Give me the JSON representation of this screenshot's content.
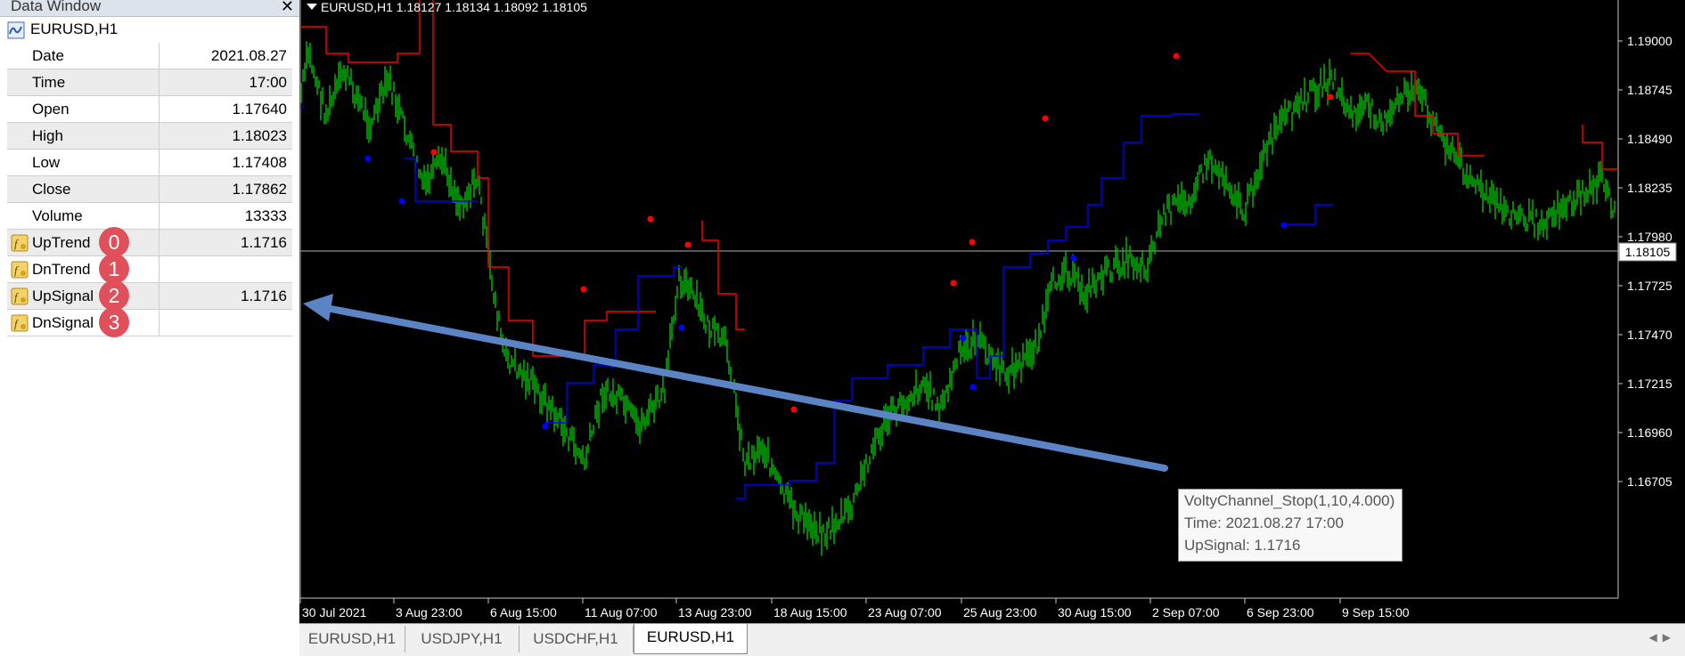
{
  "data_window": {
    "title": "Data Window",
    "symbol": "EURUSD,H1",
    "rows": [
      {
        "name": "Date",
        "value": "2021.08.27"
      },
      {
        "name": "Time",
        "value": "17:00"
      },
      {
        "name": "Open",
        "value": "1.17640"
      },
      {
        "name": "High",
        "value": "1.18023"
      },
      {
        "name": "Low",
        "value": "1.17408"
      },
      {
        "name": "Close",
        "value": "1.17862"
      },
      {
        "name": "Volume",
        "value": "13333"
      }
    ],
    "indicators": [
      {
        "name": "UpTrend",
        "value": "1.1716",
        "badge": "0"
      },
      {
        "name": "DnTrend",
        "value": "",
        "badge": "1"
      },
      {
        "name": "UpSignal",
        "value": "1.1716",
        "badge": "2"
      },
      {
        "name": "DnSignal",
        "value": "",
        "badge": "3"
      }
    ]
  },
  "chart": {
    "header": "EURUSD,H1  1.18127 1.18134 1.18092 1.18105",
    "current_price": "1.18105",
    "price_labels": [
      "1.19000",
      "1.18745",
      "1.18490",
      "1.18235",
      "1.17980",
      "1.17725",
      "1.17470",
      "1.17215",
      "1.16960",
      "1.16705"
    ],
    "time_labels": [
      "30 Jul 2021",
      "3 Aug 23:00",
      "6 Aug 15:00",
      "11 Aug 07:00",
      "13 Aug 23:00",
      "18 Aug 15:00",
      "23 Aug 07:00",
      "25 Aug 23:00",
      "30 Aug 15:00",
      "2 Sep 07:00",
      "6 Sep 23:00",
      "9 Sep 15:00"
    ],
    "colors": {
      "candles": "#00c000",
      "uptrend": "#0000ff",
      "dntrend": "#ff0000",
      "arrow": "#5b84c4",
      "background": "#000000"
    }
  },
  "tooltip": {
    "line1": "VoltyChannel_Stop(1,10,4.000)",
    "line2": "Time: 2021.08.27 17:00",
    "line3": "UpSignal: 1.1716"
  },
  "tabs": [
    {
      "label": "EURUSD,H1",
      "active": false
    },
    {
      "label": "USDJPY,H1",
      "active": false
    },
    {
      "label": "USDCHF,H1",
      "active": false
    },
    {
      "label": "EURUSD,H1",
      "active": true
    }
  ]
}
